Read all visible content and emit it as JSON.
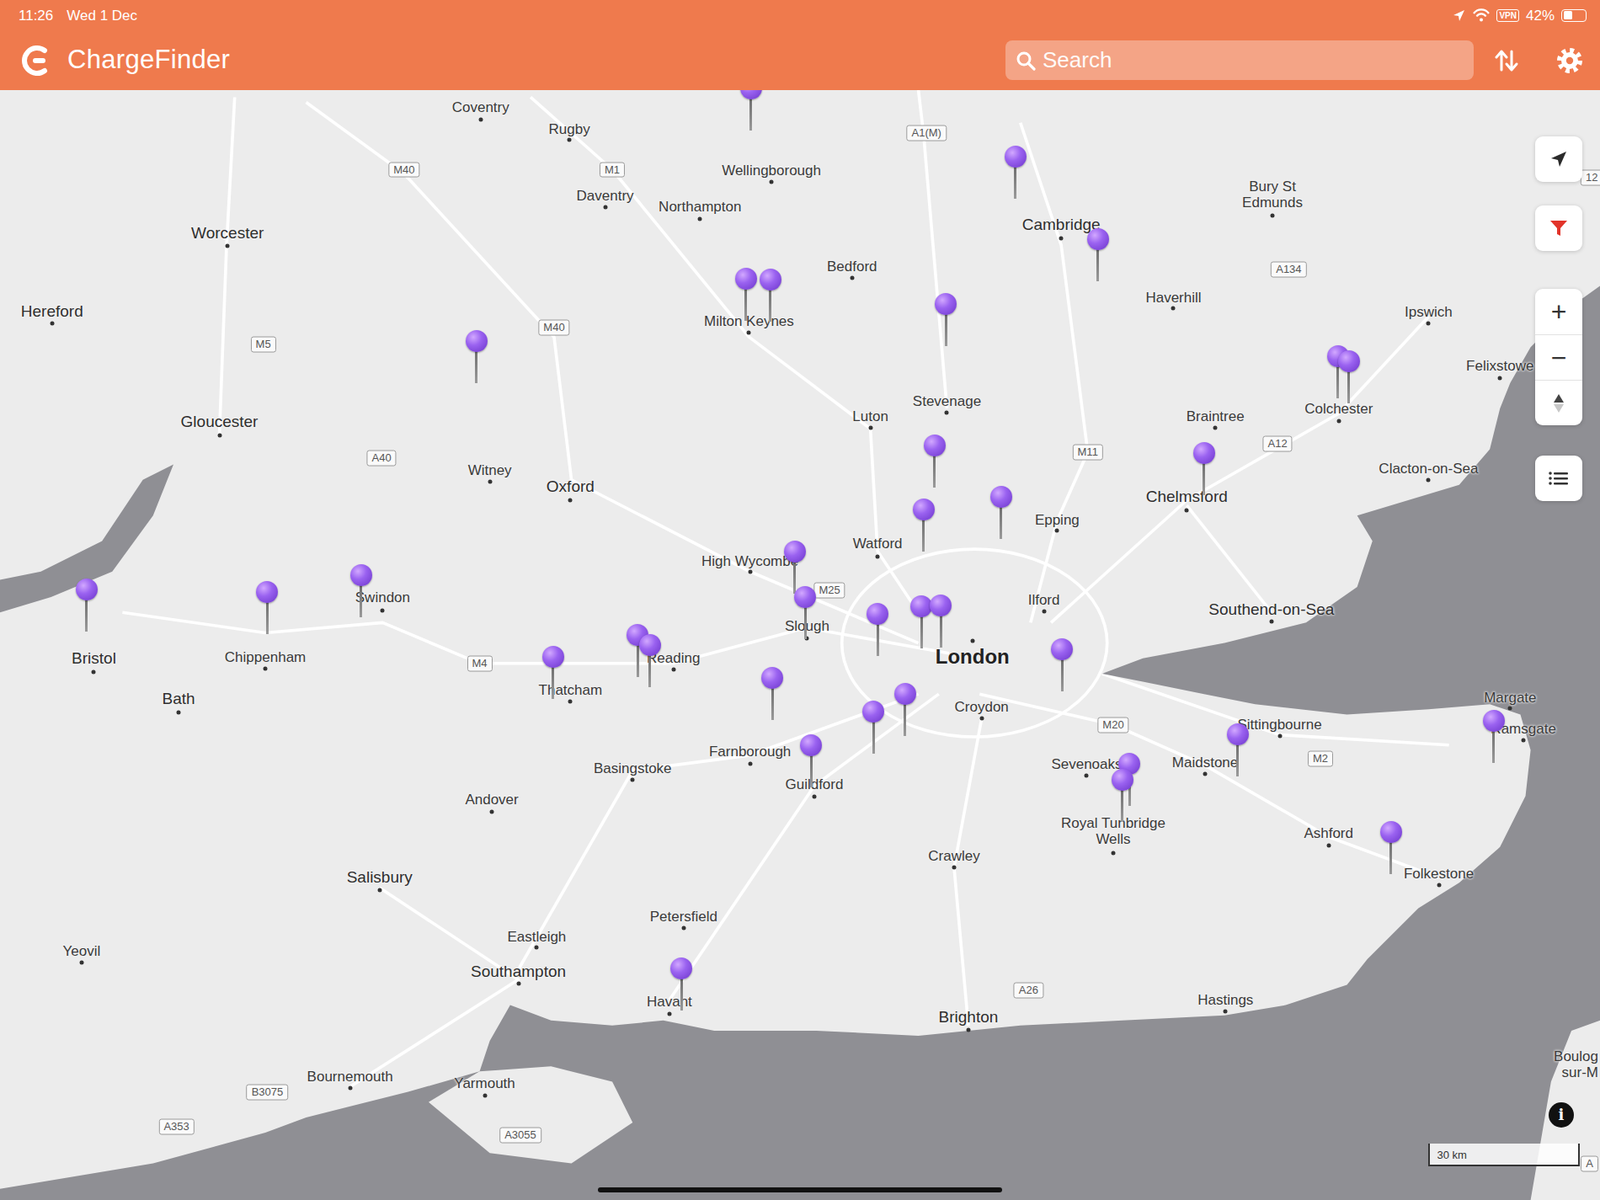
{
  "status_bar": {
    "time": "11:26",
    "date": "Wed 1 Dec",
    "vpn": "VPN",
    "battery": "42%",
    "battery_level": 0.42
  },
  "app": {
    "title": "ChargeFinder"
  },
  "search": {
    "placeholder": "Search"
  },
  "map": {
    "labels": [
      {
        "text": "Coventry",
        "kind": "city"
      },
      {
        "text": "Rugby",
        "kind": "city"
      },
      {
        "text": "Wellingborough",
        "kind": "city"
      },
      {
        "text": "Daventry",
        "kind": "city"
      },
      {
        "text": "Northampton",
        "kind": "city"
      },
      {
        "text": "Worcester",
        "kind": "bigcity"
      },
      {
        "text": "Cambridge",
        "kind": "bigcity"
      },
      {
        "text": "Bury St Edmunds",
        "kind": "city"
      },
      {
        "text": "Bedford",
        "kind": "city"
      },
      {
        "text": "Hereford",
        "kind": "bigcity"
      },
      {
        "text": "Milton Keynes",
        "kind": "city"
      },
      {
        "text": "Haverhill",
        "kind": "city"
      },
      {
        "text": "Ipswich",
        "kind": "city"
      },
      {
        "text": "Felixstowe",
        "kind": "city"
      },
      {
        "text": "Stevenage",
        "kind": "city"
      },
      {
        "text": "Luton",
        "kind": "city"
      },
      {
        "text": "Braintree",
        "kind": "city"
      },
      {
        "text": "Colchester",
        "kind": "city"
      },
      {
        "text": "Gloucester",
        "kind": "bigcity"
      },
      {
        "text": "Witney",
        "kind": "city"
      },
      {
        "text": "Clacton-on-Sea",
        "kind": "city"
      },
      {
        "text": "Oxford",
        "kind": "bigcity"
      },
      {
        "text": "Chelmsford",
        "kind": "bigcity"
      },
      {
        "text": "Epping",
        "kind": "city"
      },
      {
        "text": "Watford",
        "kind": "city"
      },
      {
        "text": "High Wycombe",
        "kind": "city"
      },
      {
        "text": "Swindon",
        "kind": "city"
      },
      {
        "text": "Slough",
        "kind": "city"
      },
      {
        "text": "Ilford",
        "kind": "city"
      },
      {
        "text": "Southend-on-Sea",
        "kind": "bigcity"
      },
      {
        "text": "Bristol",
        "kind": "bigcity"
      },
      {
        "text": "Chippenham",
        "kind": "city"
      },
      {
        "text": "Reading",
        "kind": "city"
      },
      {
        "text": "London",
        "kind": "capital"
      },
      {
        "text": "Bath",
        "kind": "bigcity"
      },
      {
        "text": "Thatcham",
        "kind": "city"
      },
      {
        "text": "Croydon",
        "kind": "city"
      },
      {
        "text": "Margate",
        "kind": "city"
      },
      {
        "text": "Sittingbourne",
        "kind": "city"
      },
      {
        "text": "Ramsgate",
        "kind": "city"
      },
      {
        "text": "Farnborough",
        "kind": "city"
      },
      {
        "text": "Basingstoke",
        "kind": "city"
      },
      {
        "text": "Sevenoaks",
        "kind": "city"
      },
      {
        "text": "Maidstone",
        "kind": "city"
      },
      {
        "text": "Guildford",
        "kind": "city"
      },
      {
        "text": "Andover",
        "kind": "city"
      },
      {
        "text": "Royal Tunbridge Wells",
        "kind": "city"
      },
      {
        "text": "Ashford",
        "kind": "city"
      },
      {
        "text": "Crawley",
        "kind": "city"
      },
      {
        "text": "Folkestone",
        "kind": "city"
      },
      {
        "text": "Salisbury",
        "kind": "bigcity"
      },
      {
        "text": "Petersfield",
        "kind": "city"
      },
      {
        "text": "Eastleigh",
        "kind": "city"
      },
      {
        "text": "Yeovil",
        "kind": "city"
      },
      {
        "text": "Southampton",
        "kind": "bigcity"
      },
      {
        "text": "Havant",
        "kind": "city"
      },
      {
        "text": "Brighton",
        "kind": "bigcity"
      },
      {
        "text": "Hastings",
        "kind": "city"
      },
      {
        "text": "Bournemouth",
        "kind": "city"
      },
      {
        "text": "Yarmouth",
        "kind": "city"
      },
      {
        "text": "Boulog",
        "kind": "city"
      },
      {
        "text": "sur-M",
        "kind": "city"
      },
      {
        "text": "M40",
        "kind": "road"
      },
      {
        "text": "M1",
        "kind": "road"
      },
      {
        "text": "A1(M)",
        "kind": "road"
      },
      {
        "text": "A134",
        "kind": "road"
      },
      {
        "text": "M5",
        "kind": "road"
      },
      {
        "text": "M40",
        "kind": "road"
      },
      {
        "text": "A40",
        "kind": "road"
      },
      {
        "text": "M11",
        "kind": "road"
      },
      {
        "text": "A12",
        "kind": "road"
      },
      {
        "text": "M4",
        "kind": "road"
      },
      {
        "text": "M25",
        "kind": "road"
      },
      {
        "text": "M20",
        "kind": "road"
      },
      {
        "text": "M2",
        "kind": "road"
      },
      {
        "text": "A26",
        "kind": "road"
      },
      {
        "text": "B3075",
        "kind": "road"
      },
      {
        "text": "A353",
        "kind": "road"
      },
      {
        "text": "A3055",
        "kind": "road"
      },
      {
        "text": "12",
        "kind": "road"
      },
      {
        "text": "A",
        "kind": "road"
      }
    ]
  },
  "controls": {
    "zoom_in": "+",
    "zoom_out": "−",
    "info": "i"
  },
  "scale": {
    "text": "30 km"
  }
}
